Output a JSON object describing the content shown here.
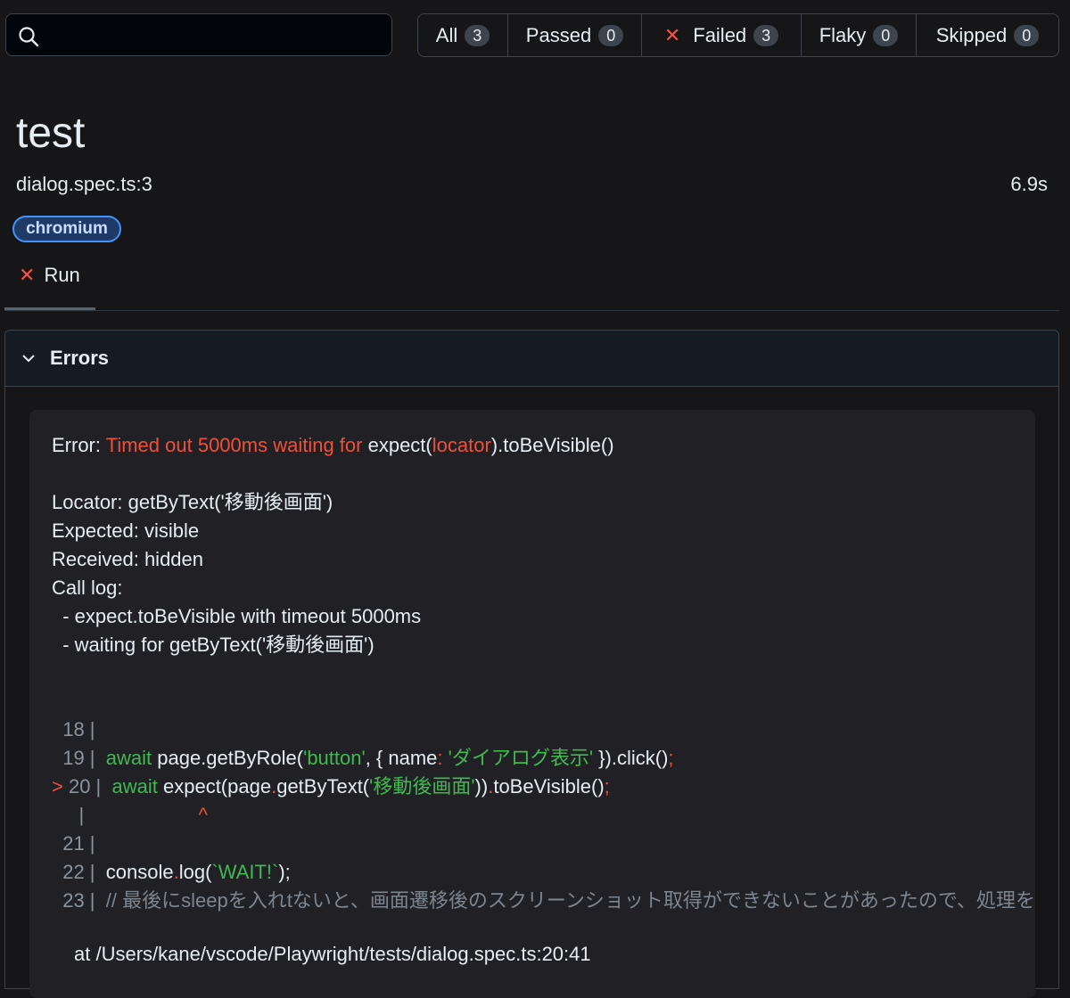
{
  "search": {
    "placeholder": "",
    "value": ""
  },
  "filters": [
    {
      "label": "All",
      "count": "3"
    },
    {
      "label": "Passed",
      "count": "0"
    },
    {
      "label": "Failed",
      "count": "3"
    },
    {
      "label": "Flaky",
      "count": "0"
    },
    {
      "label": "Skipped",
      "count": "0"
    }
  ],
  "test": {
    "title": "test",
    "location": "dialog.spec.ts:3",
    "duration": "6.9s",
    "project": "chromium"
  },
  "tabs": {
    "run": "Run"
  },
  "errors": {
    "header": "Errors",
    "message": {
      "prefix": "Error: ",
      "timeout": "Timed out 5000ms waiting for ",
      "expect_open": "expect(",
      "locator": "locator",
      "expect_close": ").toBeVisible()"
    },
    "details": [
      "Locator: getByText('移動後画面')",
      "Expected: visible",
      "Received: hidden",
      "Call log:",
      "  - expect.toBeVisible with timeout 5000ms",
      "  - waiting for getByText('移動後画面')"
    ],
    "code": {
      "l18": "  18 |",
      "l19_num": "  19 |",
      "l19_kw": "await",
      "l19_a": " page.getByRole(",
      "l19_s1": "'button'",
      "l19_b": ", { name",
      "l19_c": ": ",
      "l19_s2": "'ダイアログ表示'",
      "l19_d": " })",
      "l19_e": ".click()",
      "l19_f": ";",
      "l20_arrow": "> ",
      "l20_num": "20 |",
      "l20_kw": "await",
      "l20_a": " expect(page",
      "l20_dot": ".",
      "l20_b": "getByText(",
      "l20_s": "'移動後画面'",
      "l20_c": "))",
      "l20_dot2": ".",
      "l20_d": "toBeVisible()",
      "l20_e": ";",
      "caret_pipe": "     |",
      "caret": "^",
      "l21": "  21 |",
      "l22_num": "  22 |",
      "l22_a": "console",
      "l22_dot": ".",
      "l22_b": "log(",
      "l22_s": "`WAIT!`",
      "l22_c": ");",
      "l23_num": "  23 |",
      "l23_comment": "// 最後にsleepを入れtないと、画面遷移後のスクリーンショット取得ができないことがあったので、処理を入れた"
    },
    "stack": "at /Users/kane/vscode/Playwright/tests/dialog.spec.ts:20:41"
  },
  "colors": {
    "error_red": "#f0503a",
    "string_green": "#3fb950",
    "chip_blue": "#4493f8"
  }
}
